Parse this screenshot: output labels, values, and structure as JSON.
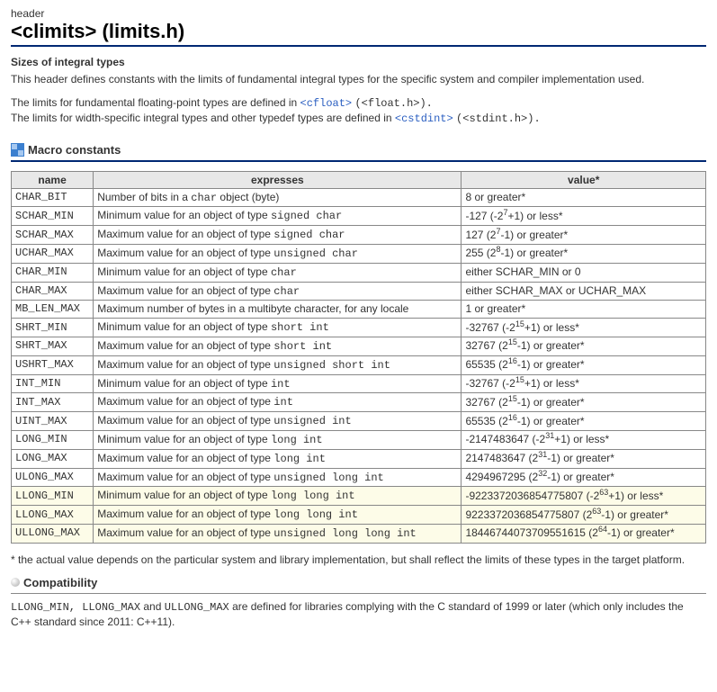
{
  "header_label": "header",
  "title_main": "<climits>",
  "title_paren": "(limits.h)",
  "subtitle": "Sizes of integral types",
  "intro": "This header defines constants with the limits of fundamental integral types for the specific system and compiler implementation used.",
  "float_line_pre": "The limits for fundamental floating-point types are defined in ",
  "float_link": "<cfloat>",
  "float_plain": " (<float.h>).",
  "width_line_pre": "The limits for width-specific integral types and other typedef types are defined in ",
  "width_link": "<cstdint>",
  "width_plain": " (<stdint.h>).",
  "section_macros": "Macro constants",
  "th_name": "name",
  "th_expresses": "expresses",
  "th_value": "value*",
  "rows": [
    {
      "name": "CHAR_BIT",
      "expr_pre": "Number of bits in a ",
      "expr_tt": "char",
      "expr_post": " object (byte)",
      "val": "8 or greater*",
      "hl": false
    },
    {
      "name": "SCHAR_MIN",
      "expr_pre": "Minimum value for an object of type ",
      "expr_tt": "signed char",
      "expr_post": "",
      "val": "-127 (-2<sup>7</sup>+1) or less*",
      "hl": false
    },
    {
      "name": "SCHAR_MAX",
      "expr_pre": "Maximum value for an object of type ",
      "expr_tt": "signed char",
      "expr_post": "",
      "val": "127 (2<sup>7</sup>-1) or greater*",
      "hl": false
    },
    {
      "name": "UCHAR_MAX",
      "expr_pre": "Maximum value for an object of type ",
      "expr_tt": "unsigned char",
      "expr_post": "",
      "val": "255 (2<sup>8</sup>-1) or greater*",
      "hl": false
    },
    {
      "name": "CHAR_MIN",
      "expr_pre": "Minimum value for an object of type ",
      "expr_tt": "char",
      "expr_post": "",
      "val": "either SCHAR_MIN or 0",
      "hl": false
    },
    {
      "name": "CHAR_MAX",
      "expr_pre": "Maximum value for an object of type ",
      "expr_tt": "char",
      "expr_post": "",
      "val": "either SCHAR_MAX or UCHAR_MAX",
      "hl": false
    },
    {
      "name": "MB_LEN_MAX",
      "expr_pre": "Maximum number of bytes in a multibyte character, for any locale",
      "expr_tt": "",
      "expr_post": "",
      "val": "1 or greater*",
      "hl": false
    },
    {
      "name": "SHRT_MIN",
      "expr_pre": "Minimum value for an object of type ",
      "expr_tt": "short int",
      "expr_post": "",
      "val": "-32767 (-2<sup>15</sup>+1) or less*",
      "hl": false
    },
    {
      "name": "SHRT_MAX",
      "expr_pre": "Maximum value for an object of type ",
      "expr_tt": "short int",
      "expr_post": "",
      "val": "32767 (2<sup>15</sup>-1) or greater*",
      "hl": false
    },
    {
      "name": "USHRT_MAX",
      "expr_pre": "Maximum value for an object of type ",
      "expr_tt": "unsigned short int",
      "expr_post": "",
      "val": "65535 (2<sup>16</sup>-1) or greater*",
      "hl": false
    },
    {
      "name": "INT_MIN",
      "expr_pre": "Minimum value for an object of type ",
      "expr_tt": "int",
      "expr_post": "",
      "val": "-32767 (-2<sup>15</sup>+1) or less*",
      "hl": false
    },
    {
      "name": "INT_MAX",
      "expr_pre": "Maximum value for an object of type ",
      "expr_tt": "int",
      "expr_post": "",
      "val": "32767 (2<sup>15</sup>-1) or greater*",
      "hl": false
    },
    {
      "name": "UINT_MAX",
      "expr_pre": "Maximum value for an object of type ",
      "expr_tt": "unsigned int",
      "expr_post": "",
      "val": "65535 (2<sup>16</sup>-1) or greater*",
      "hl": false
    },
    {
      "name": "LONG_MIN",
      "expr_pre": "Minimum value for an object of type ",
      "expr_tt": "long int",
      "expr_post": "",
      "val": "-2147483647 (-2<sup>31</sup>+1) or less*",
      "hl": false
    },
    {
      "name": "LONG_MAX",
      "expr_pre": "Maximum value for an object of type ",
      "expr_tt": "long int",
      "expr_post": "",
      "val": "2147483647 (2<sup>31</sup>-1) or greater*",
      "hl": false
    },
    {
      "name": "ULONG_MAX",
      "expr_pre": "Maximum value for an object of type ",
      "expr_tt": "unsigned long int",
      "expr_post": "",
      "val": "4294967295 (2<sup>32</sup>-1) or greater*",
      "hl": false
    },
    {
      "name": "LLONG_MIN",
      "expr_pre": "Minimum value for an object of type ",
      "expr_tt": "long long int",
      "expr_post": "",
      "val": "-9223372036854775807 (-2<sup>63</sup>+1) or less*",
      "hl": true
    },
    {
      "name": "LLONG_MAX",
      "expr_pre": "Maximum value for an object of type ",
      "expr_tt": "long long int",
      "expr_post": "",
      "val": "9223372036854775807 (2<sup>63</sup>-1) or greater*",
      "hl": true
    },
    {
      "name": "ULLONG_MAX",
      "expr_pre": "Maximum value for an object of type ",
      "expr_tt": "unsigned long long int",
      "expr_post": "",
      "val": "18446744073709551615 (2<sup>64</sup>-1) or greater*",
      "hl": true
    }
  ],
  "footnote": "* the actual value depends on the particular system and library implementation, but shall reflect the limits of these types in the target platform.",
  "section_compat": "Compatibility",
  "compat_tt": "LLONG_MIN, LLONG_MAX",
  "compat_and": " and ",
  "compat_tt2": "ULLONG_MAX",
  "compat_text": " are defined for libraries complying with the C standard of 1999 or later (which only includes the C++ standard since 2011: C++11)."
}
